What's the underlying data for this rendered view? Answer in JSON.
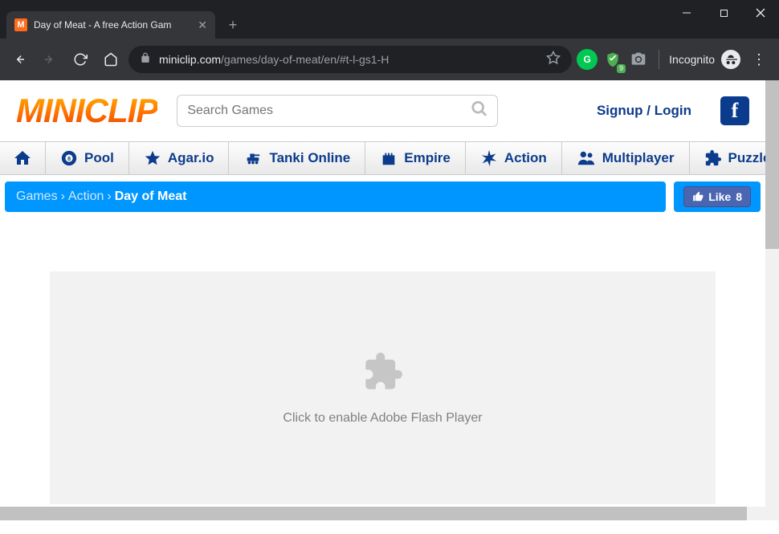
{
  "browser": {
    "tab_title": "Day of Meat - A free Action Gam",
    "url_domain": "miniclip.com",
    "url_path": "/games/day-of-meat/en/#t-l-gs1-H",
    "incognito_label": "Incognito",
    "ext_badge": "9"
  },
  "header": {
    "logo_text": "MINICLIP",
    "search_placeholder": "Search Games",
    "auth_label": "Signup / Login"
  },
  "nav": {
    "items": [
      {
        "label": ""
      },
      {
        "label": "Pool"
      },
      {
        "label": "Agar.io"
      },
      {
        "label": "Tanki Online"
      },
      {
        "label": "Empire"
      },
      {
        "label": "Action"
      },
      {
        "label": "Multiplayer"
      },
      {
        "label": "Puzzle"
      }
    ]
  },
  "breadcrumb": {
    "root": "Games",
    "category": "Action",
    "page": "Day of Meat"
  },
  "like": {
    "label": "Like",
    "count": "8"
  },
  "game": {
    "flash_text": "Click to enable Adobe Flash Player"
  }
}
